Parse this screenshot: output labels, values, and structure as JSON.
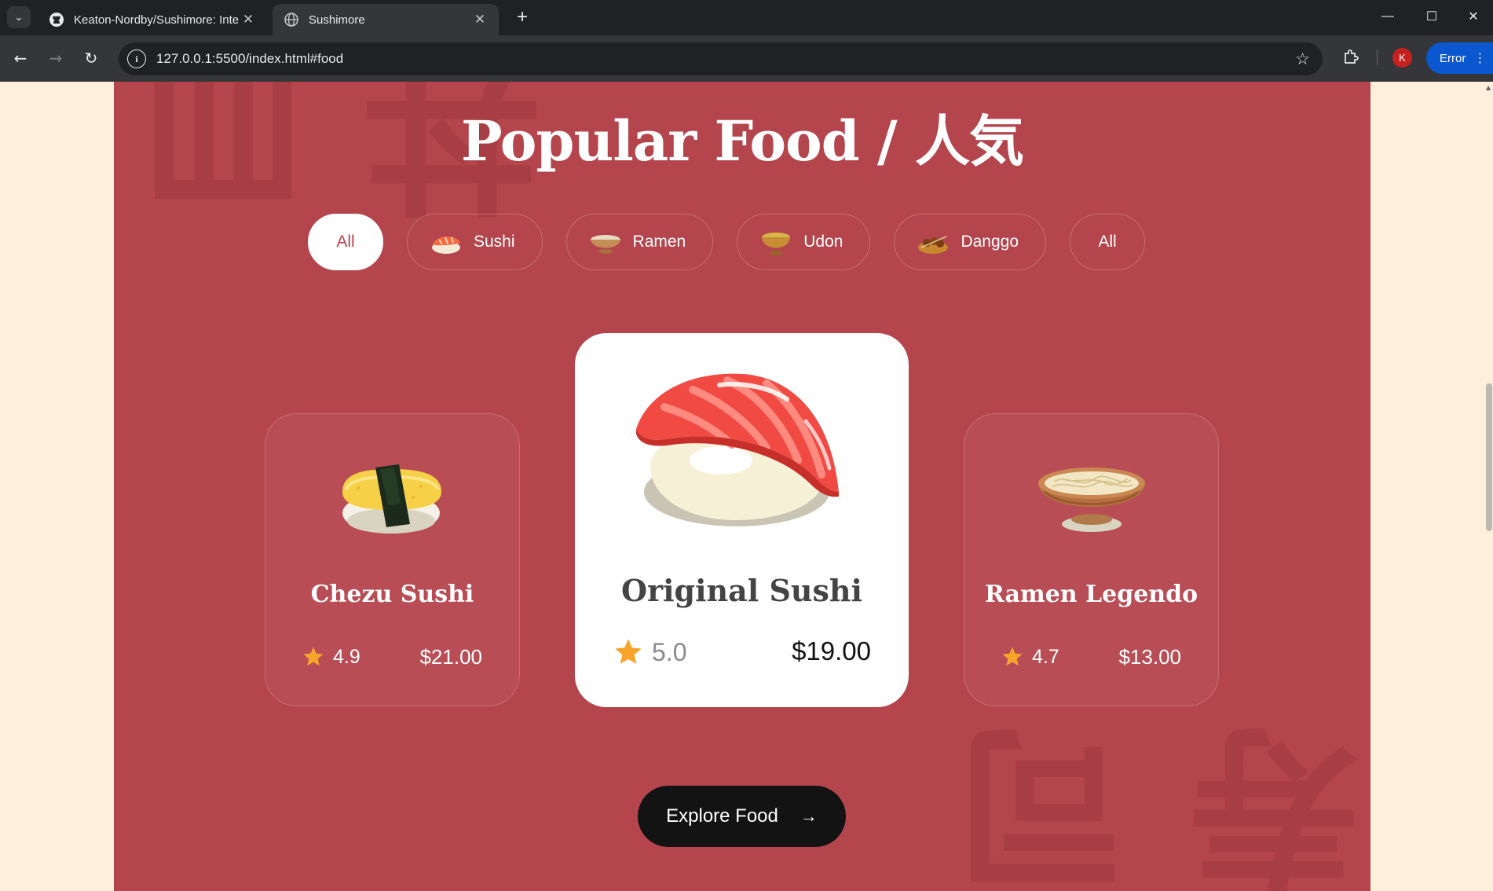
{
  "browser": {
    "tabs": [
      {
        "title": "Keaton-Nordby/Sushimore: Inte",
        "icon": "github-icon",
        "active": false
      },
      {
        "title": "Sushimore",
        "icon": "globe-icon",
        "active": true
      }
    ],
    "new_tab": "+",
    "window_controls": {
      "minimize": "—",
      "maximize": "☐",
      "close": "✕"
    },
    "url": "127.0.0.1:5500/index.html#food",
    "profile_initial": "K",
    "error_label": "Error"
  },
  "page": {
    "heading": "Popular Food / 人気",
    "watermark_top": "丼 皿",
    "watermark_bottom": "寿 司",
    "filters": [
      {
        "label": "All",
        "icon": null,
        "active": true
      },
      {
        "label": "Sushi",
        "icon": "sushi-icon",
        "active": false
      },
      {
        "label": "Ramen",
        "icon": "ramen-icon",
        "active": false
      },
      {
        "label": "Udon",
        "icon": "udon-icon",
        "active": false
      },
      {
        "label": "Danggo",
        "icon": "dango-icon",
        "active": false
      },
      {
        "label": "All",
        "icon": null,
        "active": false
      }
    ],
    "cards": [
      {
        "name": "Chezu Sushi",
        "rating": "4.9",
        "price": "$21.00",
        "image": "tamago-sushi-image",
        "featured": false
      },
      {
        "name": "Original Sushi",
        "rating": "5.0",
        "price": "$19.00",
        "image": "salmon-sushi-image",
        "featured": true
      },
      {
        "name": "Ramen Legendo",
        "rating": "4.7",
        "price": "$13.00",
        "image": "ramen-bowl-image",
        "featured": false
      }
    ],
    "explore_button": "Explore Food",
    "colors": {
      "section_bg": "#b4454d",
      "page_bg": "#fdefdc",
      "star": "#f6a52a",
      "button_bg": "#131313"
    }
  }
}
